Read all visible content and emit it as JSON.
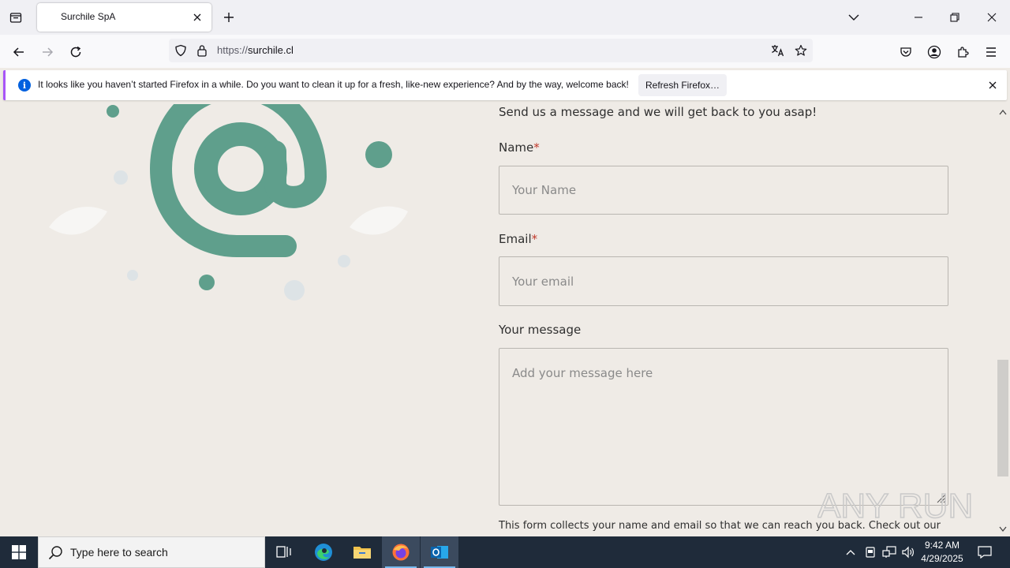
{
  "browser": {
    "tab_title": "Surchile SpA",
    "url_prefix": "https://",
    "url_host": "surchile.cl"
  },
  "notification": {
    "message": "It looks like you haven’t started Firefox in a while. Do you want to clean it up for a fresh, like-new experience? And by the way, welcome back!",
    "button_label": "Refresh Firefox…"
  },
  "form": {
    "intro": "Send us a message and we will get back to you asap!",
    "name_label": "Name",
    "name_placeholder": "Your Name",
    "email_label": "Email",
    "email_placeholder": "Your email",
    "message_label": "Your message",
    "message_placeholder": "Add your message here",
    "required_marker": "*",
    "footnote": "This form collects your name and email so that we can reach you back. Check out our"
  },
  "colors": {
    "brand_green": "#5f9f8c",
    "required": "#c0392b",
    "taskbar": "#1f2b3a"
  },
  "taskbar": {
    "search_placeholder": "Type here to search",
    "time": "9:42 AM",
    "date": "4/29/2025"
  },
  "watermark": "ANY RUN"
}
